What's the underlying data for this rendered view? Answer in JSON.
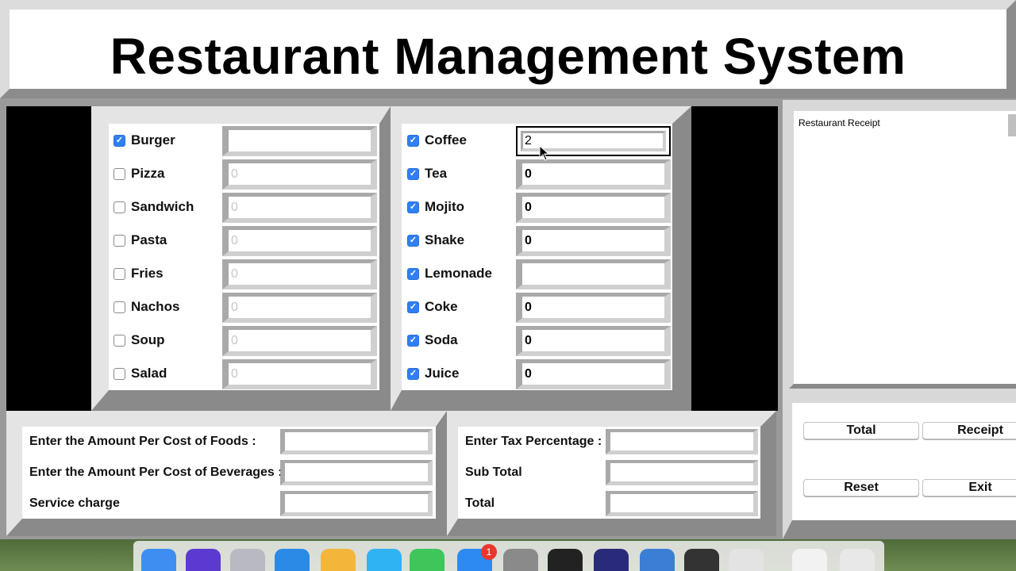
{
  "app": {
    "title": "Restaurant Management System"
  },
  "foods": [
    {
      "label": "Burger",
      "checked": true,
      "value": "",
      "state": "enabled"
    },
    {
      "label": "Pizza",
      "checked": false,
      "value": "0",
      "state": "disabled"
    },
    {
      "label": "Sandwich",
      "checked": false,
      "value": "0",
      "state": "disabled"
    },
    {
      "label": "Pasta",
      "checked": false,
      "value": "0",
      "state": "disabled"
    },
    {
      "label": "Fries",
      "checked": false,
      "value": "0",
      "state": "disabled"
    },
    {
      "label": "Nachos",
      "checked": false,
      "value": "0",
      "state": "disabled"
    },
    {
      "label": "Soup",
      "checked": false,
      "value": "0",
      "state": "disabled"
    },
    {
      "label": "Salad",
      "checked": false,
      "value": "0",
      "state": "disabled"
    }
  ],
  "beverages": [
    {
      "label": "Coffee",
      "checked": true,
      "value": "2",
      "state": "focused"
    },
    {
      "label": "Tea",
      "checked": true,
      "value": "0",
      "state": "enabled"
    },
    {
      "label": "Mojito",
      "checked": true,
      "value": "0",
      "state": "enabled"
    },
    {
      "label": "Shake",
      "checked": true,
      "value": "0",
      "state": "enabled"
    },
    {
      "label": "Lemonade",
      "checked": true,
      "value": "",
      "state": "enabled"
    },
    {
      "label": "Coke",
      "checked": true,
      "value": "0",
      "state": "enabled"
    },
    {
      "label": "Soda",
      "checked": true,
      "value": "0",
      "state": "enabled"
    },
    {
      "label": "Juice",
      "checked": true,
      "value": "0",
      "state": "enabled"
    }
  ],
  "costs_left": [
    {
      "label": "Enter the Amount Per Cost of Foods :",
      "value": ""
    },
    {
      "label": "Enter the Amount Per Cost of Beverages :",
      "value": ""
    },
    {
      "label": "Service charge",
      "value": ""
    }
  ],
  "costs_right": [
    {
      "label": "Enter Tax Percentage :",
      "value": ""
    },
    {
      "label": "Sub Total",
      "value": ""
    },
    {
      "label": "Total",
      "value": ""
    }
  ],
  "receipt": {
    "text": "Restaurant Receipt"
  },
  "buttons": {
    "total": "Total",
    "receipt": "Receipt",
    "reset": "Reset",
    "exit": "Exit"
  },
  "colors": {
    "checkbox_checked": "#2f7ff6",
    "frame_light": "#e4e4e4",
    "frame_dark": "#8a8a8a",
    "panel_black": "#000000"
  },
  "dock": {
    "icons": [
      "finder-icon",
      "siri-icon",
      "launchpad-icon",
      "safari-icon",
      "photos-icon",
      "messages-icon",
      "facetime-icon",
      "app-store-icon",
      "system-preferences-icon",
      "terminal-icon",
      "eclipse-icon",
      "keynote-icon",
      "quicktime-icon",
      "pen-icon",
      "preview-icon",
      "trash-icon"
    ],
    "app_store_badge": "1"
  }
}
